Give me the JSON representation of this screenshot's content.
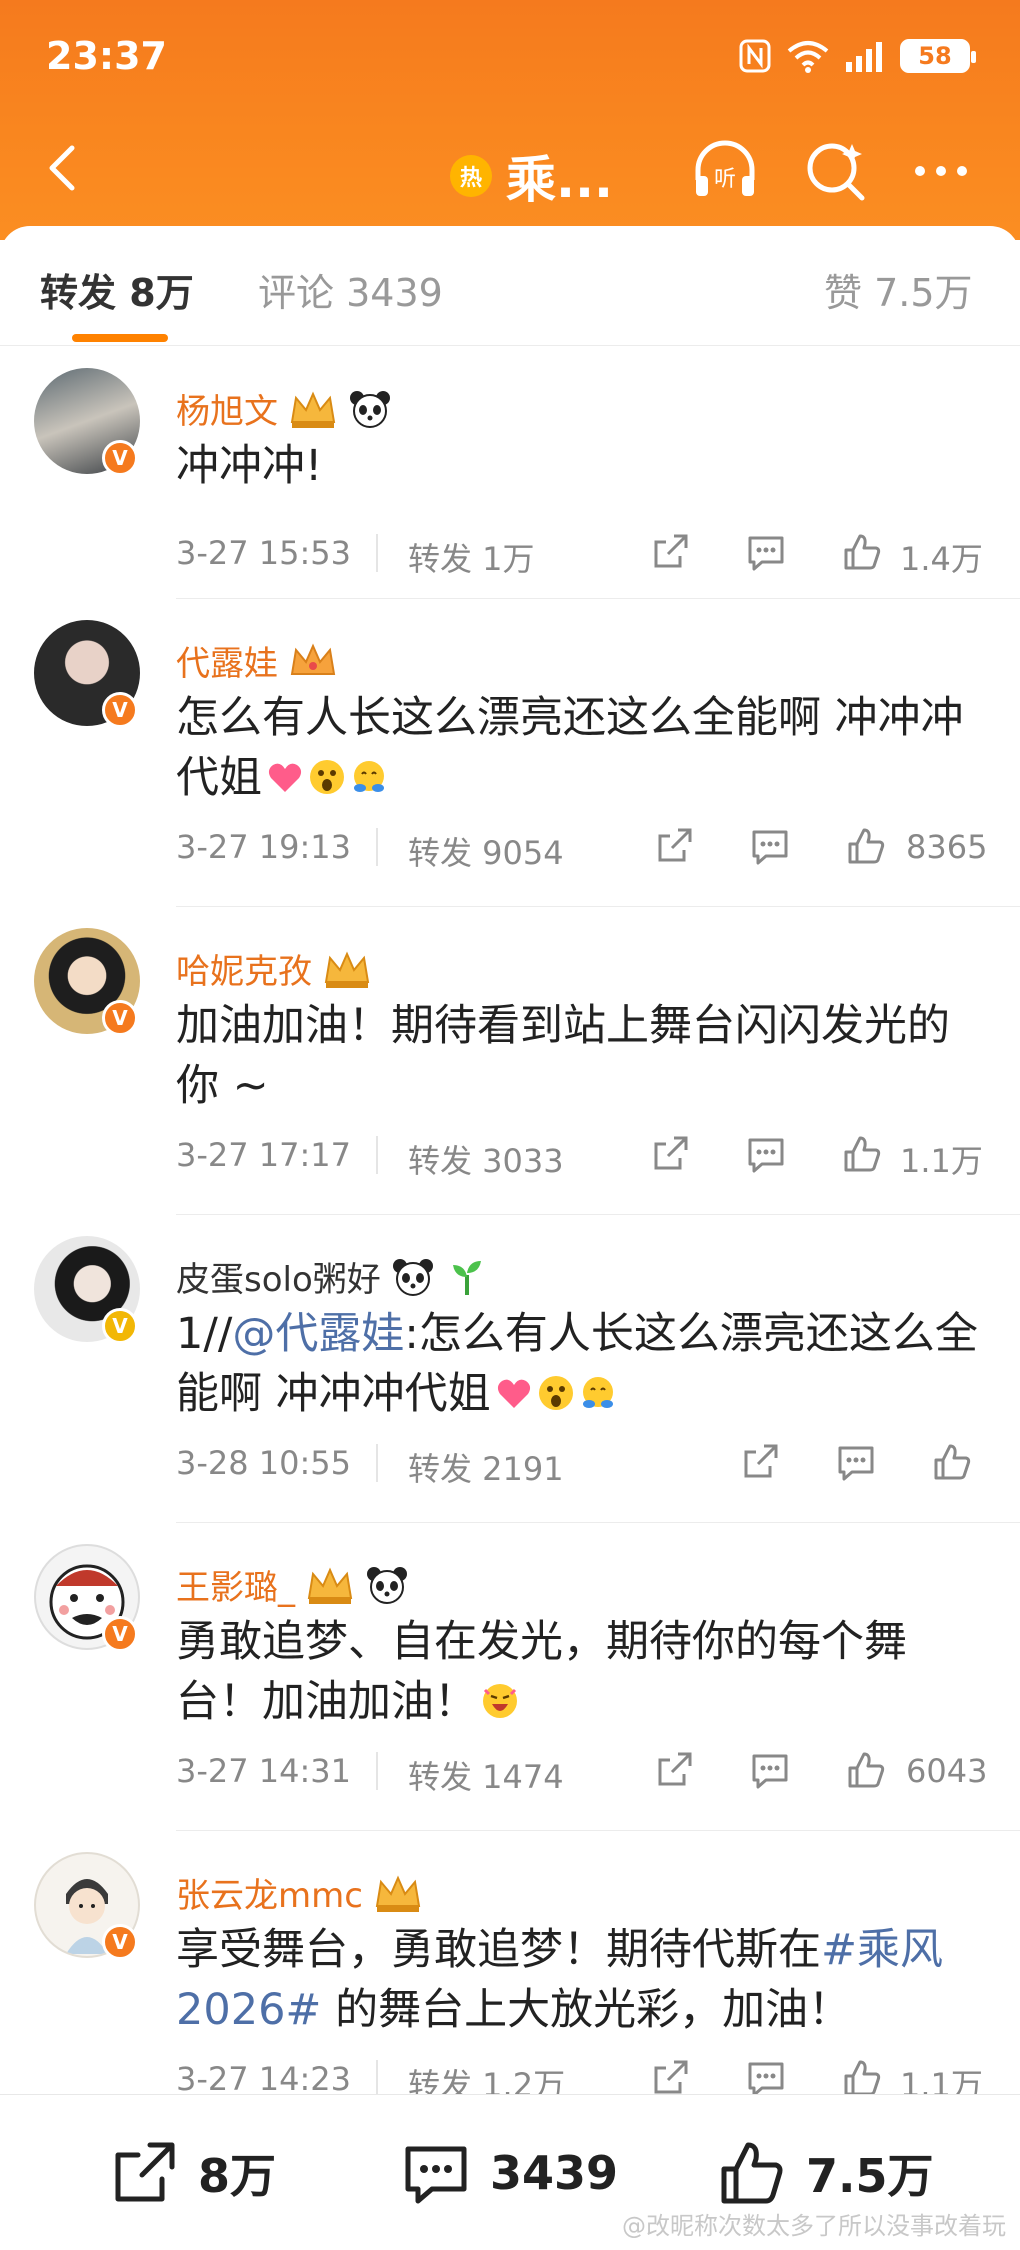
{
  "status": {
    "time": "23:37",
    "battery": "58"
  },
  "nav": {
    "hot_badge": "热",
    "title": "乘..."
  },
  "tabs": {
    "repost_label": "转发",
    "repost_count": "8万",
    "comment_label": "评论",
    "comment_count": "3439",
    "like_label": "赞",
    "like_count": "7.5万"
  },
  "comments": [
    {
      "name": "杨旭文",
      "text": "冲冲冲!",
      "date": "3-27 15:53",
      "forward": "转发 1万",
      "likes": "1.4万"
    },
    {
      "name": "代露娃",
      "text": "怎么有人长这么漂亮还这么全能啊 冲冲冲代姐",
      "date": "3-27 19:13",
      "forward": "转发 9054",
      "likes": "8365"
    },
    {
      "name": "哈妮克孜",
      "text": "加油加油！期待看到站上舞台闪闪发光的你 ~",
      "date": "3-27 17:17",
      "forward": "转发 3033",
      "likes": "1.1万"
    },
    {
      "name": "皮蛋solo粥好",
      "text_prefix": "1//",
      "mention": "@代露娃",
      "text": ":怎么有人长这么漂亮还这么全能啊 冲冲冲代姐",
      "date": "3-28 10:55",
      "forward": "转发 2191",
      "likes": ""
    },
    {
      "name": "王影璐_",
      "text": "勇敢追梦、自在发光，期待你的每个舞台！加油加油！",
      "date": "3-27 14:31",
      "forward": "转发 1474",
      "likes": "6043"
    },
    {
      "name": "张云龙mmc",
      "text_a": "享受舞台，勇敢追梦！期待代斯在",
      "hashtag": "#乘风2026#",
      "text_b": " 的舞台上大放光彩，加油！",
      "date": "3-27 14:23",
      "forward": "转发 1.2万",
      "likes": "1.1万"
    }
  ],
  "bottom": {
    "repost": "8万",
    "comment": "3439",
    "like": "7.5万"
  },
  "watermark": "@改昵称次数太多了所以没事改着玩",
  "colors": {
    "header": "#f57a1e",
    "accent": "#ff8200",
    "name": "#e8721d",
    "link": "#4e6fa7"
  }
}
